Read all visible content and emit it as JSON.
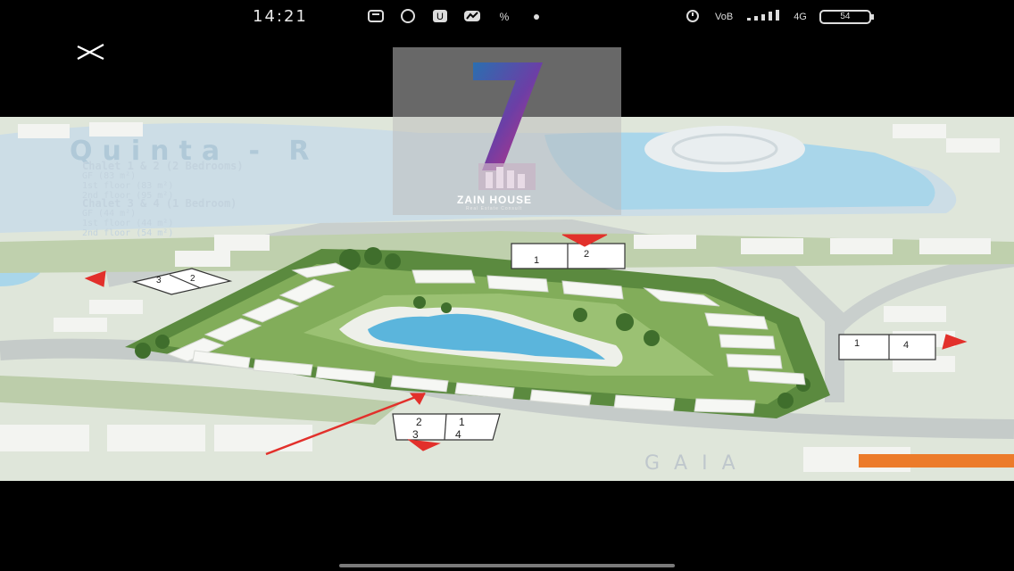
{
  "status_bar": {
    "time": "14:21",
    "network_label": "VoB",
    "signal_label": "4G",
    "battery": "54",
    "icons": [
      "message-icon",
      "whatsapp-icon",
      "u-app-icon",
      "photo-app-icon",
      "percent-icon",
      "dot-icon",
      "alarm-icon",
      "signal-icon",
      "battery-icon"
    ]
  },
  "viewer": {
    "close_icon": "close-icon"
  },
  "plan": {
    "title": "Quinta - R",
    "spec_a": {
      "heading": "Chalet 1 & 2 (2 Bedrooms)",
      "lines": [
        "GF (83 m²)",
        "1st floor (83 m²)",
        "2nd floor (95 m²)"
      ]
    },
    "spec_b": {
      "heading": "Chalet 3 & 4 (1 Bedroom)",
      "lines": [
        "GF (44 m²)",
        "1st floor (44 m²)",
        "2nd floor (54 m²)"
      ]
    },
    "brand": "GAIA",
    "unit_labels": [
      "1",
      "2",
      "3",
      "4"
    ]
  },
  "watermark": {
    "name": "ZAIN HOUSE",
    "subtitle": "Real Estate Consult"
  },
  "colors": {
    "pool": "#5bb5dc",
    "lawn": "#6f9a4c",
    "orange": "#ec7b2a",
    "arrow": "#e2302b"
  }
}
